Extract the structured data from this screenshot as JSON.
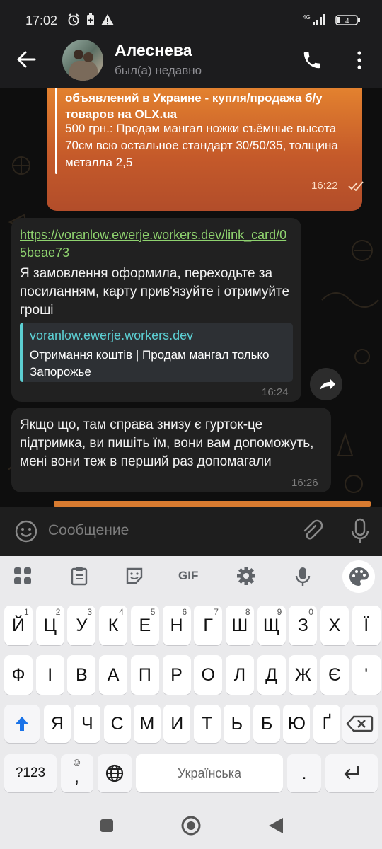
{
  "status": {
    "time": "17:02",
    "battery": "4"
  },
  "header": {
    "name": "Алеснева",
    "last_seen": "был(а) недавно"
  },
  "messages": {
    "outgoing": {
      "preview_title": "Сервис объявлений OLX: сайт частных объявлений в Украине - купля/продажа б/у товаров на OLX.ua",
      "text": "500 грн.: Продам мангал ножки съёмные высота 70см всю остальное стандарт 30/50/35, толщина металла 2,5",
      "time": "16:22"
    },
    "incoming1": {
      "link": "https://voranlow.ewerje.workers.dev/link_card/05beae73",
      "text": "Я замовлення оформила, переходьте за посиланням, карту прив'язуйте і отримуйте гроші",
      "preview_site": "voranlow.ewerje.workers.dev",
      "preview_text": "Отримання коштів | Продам мангал только  Запорожье",
      "time": "16:24"
    },
    "incoming2": {
      "text": "Якщо що, там справа знизу є гурток-це підтримка, ви пишіть їм, вони вам допоможуть, мені вони теж в перший раз допомагали",
      "time": "16:26"
    }
  },
  "composer": {
    "placeholder": "Сообщение"
  },
  "keyboard": {
    "toolbar": {
      "gif": "GIF"
    },
    "row1": [
      {
        "k": "Й",
        "h": "1"
      },
      {
        "k": "Ц",
        "h": "2"
      },
      {
        "k": "У",
        "h": "3"
      },
      {
        "k": "К",
        "h": "4"
      },
      {
        "k": "Е",
        "h": "5"
      },
      {
        "k": "Н",
        "h": "6"
      },
      {
        "k": "Г",
        "h": "7"
      },
      {
        "k": "Ш",
        "h": "8"
      },
      {
        "k": "Щ",
        "h": "9"
      },
      {
        "k": "З",
        "h": "0"
      },
      {
        "k": "Х",
        "h": ""
      },
      {
        "k": "Ї",
        "h": ""
      }
    ],
    "row2": [
      "Ф",
      "І",
      "В",
      "А",
      "П",
      "Р",
      "О",
      "Л",
      "Д",
      "Ж",
      "Є",
      "'"
    ],
    "row3": [
      "Я",
      "Ч",
      "С",
      "М",
      "И",
      "Т",
      "Ь",
      "Б",
      "Ю",
      "Ґ"
    ],
    "symbols": "?123",
    "comma": ",",
    "space": "Українська",
    "period": "."
  }
}
